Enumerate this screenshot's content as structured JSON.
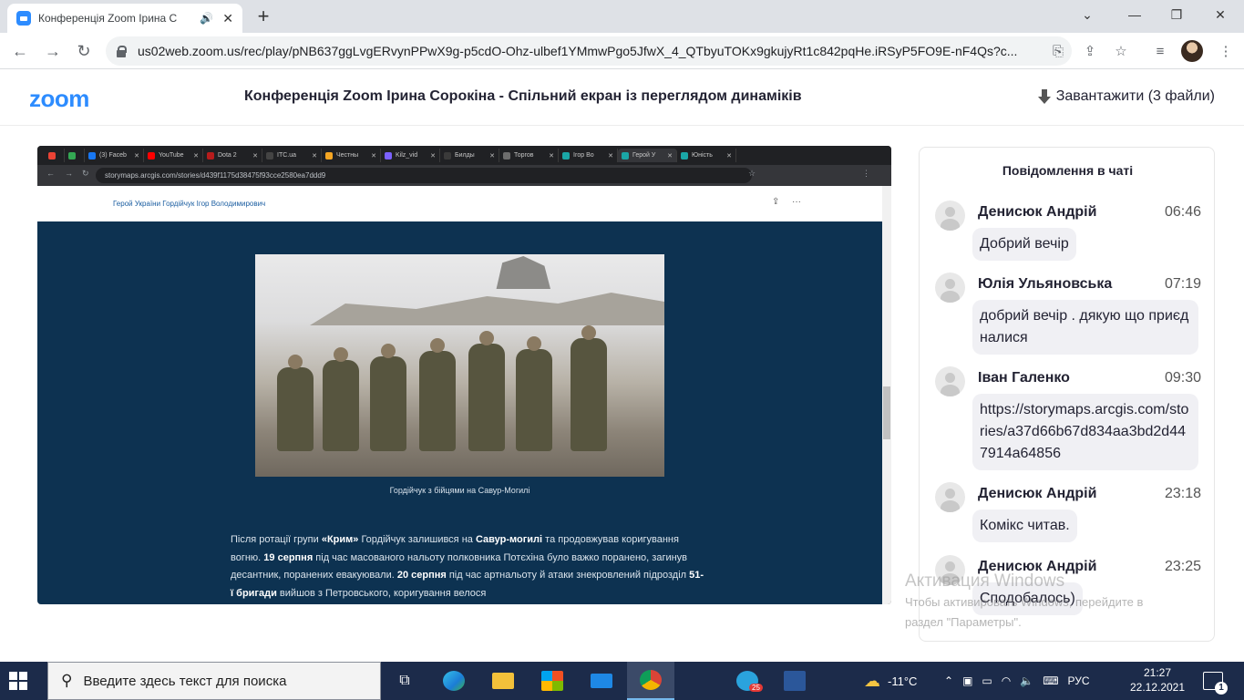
{
  "browser": {
    "tab_title": "Конференція Zoom Ірина С",
    "url": "us02web.zoom.us/rec/play/pNB637ggLvgERvynPPwX9g-p5cdO-Ohz-ulbef1YMmwPgo5JfwX_4_QTbyuTOKx9gkujyRt1c842pqHe.iRSyP5FO9E-nF4Qs?c..."
  },
  "zoom": {
    "logo": "zoom",
    "title": "Конференція Zoom Ірина Сорокіна - Спільний екран із переглядом динаміків",
    "download_label": "Завантажити (3 файли)"
  },
  "shared_screen": {
    "tabs": [
      {
        "label": "",
        "color": "#ea4335"
      },
      {
        "label": "",
        "color": "#34a853"
      },
      {
        "label": "(3) Faceb",
        "color": "#1877f2"
      },
      {
        "label": "YouTube",
        "color": "#ff0000"
      },
      {
        "label": "Dota 2",
        "color": "#b71c1c"
      },
      {
        "label": "ITC.ua",
        "color": "#444444"
      },
      {
        "label": "Честны",
        "color": "#f5a623"
      },
      {
        "label": "Kilz_vid",
        "color": "#7b61ff"
      },
      {
        "label": "Билды",
        "color": "#3a3a3a"
      },
      {
        "label": "Торгов",
        "color": "#6d6d6d"
      },
      {
        "label": "Ігор Во",
        "color": "#1aa6a6"
      },
      {
        "label": "Герой У",
        "color": "#1aa6a6",
        "active": true
      },
      {
        "label": "Юність",
        "color": "#1aa6a6"
      }
    ],
    "url": "storymaps.arcgis.com/stories/d439f1175d38475f93cce2580ea7ddd9",
    "page_title": "Герой України Гордійчук Ігор Володимирович",
    "caption": "Гордійчук з бійцями на Савур-Могилі",
    "paragraph": [
      {
        "t": "Після ротації групи ",
        "b": false
      },
      {
        "t": "«Крим»",
        "b": true
      },
      {
        "t": " Гордійчук залишився на ",
        "b": false
      },
      {
        "t": "Савур-могилі",
        "b": true
      },
      {
        "t": " та продовжував коригування вогню. ",
        "b": false
      },
      {
        "t": "19 серпня",
        "b": true
      },
      {
        "t": " під час масованого нальоту полковника Потєхіна було важко поранено, загинув десантник, поранених евакуювали. ",
        "b": false
      },
      {
        "t": "20 серпня",
        "b": true
      },
      {
        "t": " під час артнальоту й атаки знекровлений підрозділ ",
        "b": false
      },
      {
        "t": "51-ї бригади",
        "b": true
      },
      {
        "t": " вийшов з Петровського, коригування велося",
        "b": false
      }
    ]
  },
  "chat": {
    "title": "Повідомлення в чаті",
    "messages": [
      {
        "sender": "Денисюк Андрій",
        "time": "06:46",
        "text": "Добрий вечір"
      },
      {
        "sender": "Юлія Ульяновська",
        "time": "07:19",
        "text": "добрий вечір . дякую що приєдналися"
      },
      {
        "sender": "Іван Галенко",
        "time": "09:30",
        "text": "https://storymaps.arcgis.com/stories/a37d66b67d834aa3bd2d447914a64856"
      },
      {
        "sender": "Денисюк Андрій",
        "time": "23:18",
        "text": "Комікс читав."
      },
      {
        "sender": "Денисюк Андрій",
        "time": "23:25",
        "text": "Сподобалось)"
      }
    ]
  },
  "watermark": {
    "line1": "Активация Windows",
    "line2": "Чтобы активировать Windows, перейдите в",
    "line3": "раздел \"Параметры\"."
  },
  "taskbar": {
    "search_placeholder": "Введите здесь текст для поиска",
    "temperature": "-11°C",
    "language": "РУС",
    "time": "21:27",
    "date": "22.12.2021",
    "notification_count": "1",
    "telegram_badge": "25"
  },
  "colors": {
    "zoom_blue": "#2d8cff",
    "story_bg": "#0d3251",
    "taskbar": "#1c2b4a"
  }
}
